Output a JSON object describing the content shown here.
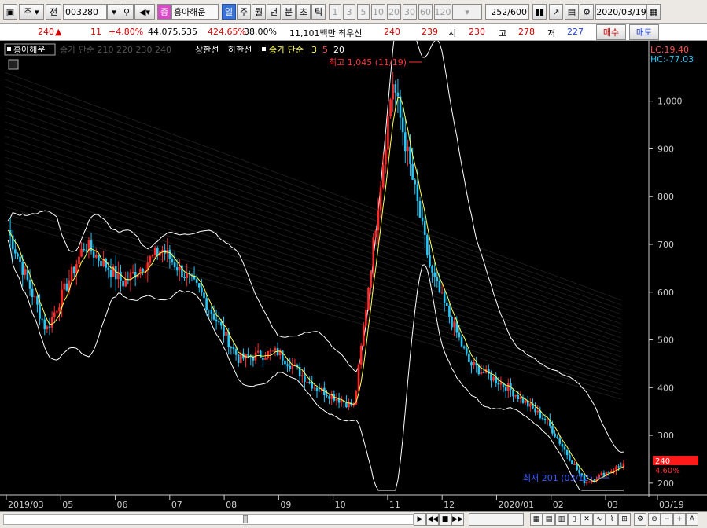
{
  "toolbar": {
    "period_sel": "주",
    "mode_sel": "전",
    "stock_code": "003280",
    "stock_name": "흥아해운",
    "stock_badge": "증",
    "tabs": [
      "일",
      "주",
      "월",
      "년",
      "분",
      "초",
      "틱"
    ],
    "numbers": [
      "1",
      "3",
      "5",
      "10",
      "20",
      "30",
      "60",
      "120"
    ],
    "count": "252",
    "count_total": "/600",
    "date": "2020/03/19"
  },
  "info": {
    "price": "240",
    "change": "11",
    "change_pct": "+4.80%",
    "volume": "44,075,535",
    "volume_pct": "424.65%",
    "ratio": "38.00%",
    "amount": "11,101백만",
    "prio_label": "최우선",
    "ask": "240",
    "bid": "239",
    "open_label": "시",
    "open": "230",
    "high_label": "고",
    "high": "278",
    "low_label": "저",
    "low": "227",
    "buy_btn": "매수",
    "sell_btn": "매도"
  },
  "legend": {
    "name": "흥아해운",
    "ma_dim": "종가 단순 210 220 230 240",
    "limit_up": "상한선",
    "limit_down": "하한선",
    "ma_label": "종가 단순",
    "ma3": "3",
    "ma5": "5",
    "ma20": "20"
  },
  "chart_data": {
    "type": "candlestick",
    "title": "",
    "lc": "LC:19.40",
    "hc": "HC:-77.03",
    "high_annot": "최고 1,045 (11/19)",
    "low_annot": "최저 201 (03/12)",
    "last_price": "240",
    "last_pct": "4.60%",
    "y_ticks": [
      "1,000",
      "900",
      "800",
      "700",
      "600",
      "500",
      "400",
      "300",
      "200"
    ],
    "ylim": [
      180,
      1090
    ],
    "x_ticks": [
      "2019/03",
      "05",
      "06",
      "07",
      "08",
      "09",
      "10",
      "11",
      "12",
      "2020/01",
      "02",
      "03",
      "03/19"
    ],
    "key_points": [
      {
        "date": "2019/03",
        "close": 730
      },
      {
        "date": "2019/03",
        "close": 520
      },
      {
        "date": "2019/04",
        "close": 700
      },
      {
        "date": "2019/05",
        "close": 620
      },
      {
        "date": "2019/06",
        "close": 690
      },
      {
        "date": "2019/07",
        "close": 600
      },
      {
        "date": "2019/08",
        "close": 460
      },
      {
        "date": "2019/09",
        "close": 475
      },
      {
        "date": "2019/10",
        "close": 400
      },
      {
        "date": "2019/11",
        "close": 360
      },
      {
        "date": "2019/11/19",
        "close": 1045
      },
      {
        "date": "2019/12",
        "close": 640
      },
      {
        "date": "2020/01",
        "close": 450
      },
      {
        "date": "2020/02",
        "close": 400
      },
      {
        "date": "2020/03",
        "close": 330
      },
      {
        "date": "2020/03/12",
        "close": 201
      },
      {
        "date": "2020/03/19",
        "close": 240
      }
    ]
  },
  "colors": {
    "up": "#ff2a2a",
    "down": "#27c6f5",
    "ma": "#ffff55",
    "band": "#ffffff"
  }
}
